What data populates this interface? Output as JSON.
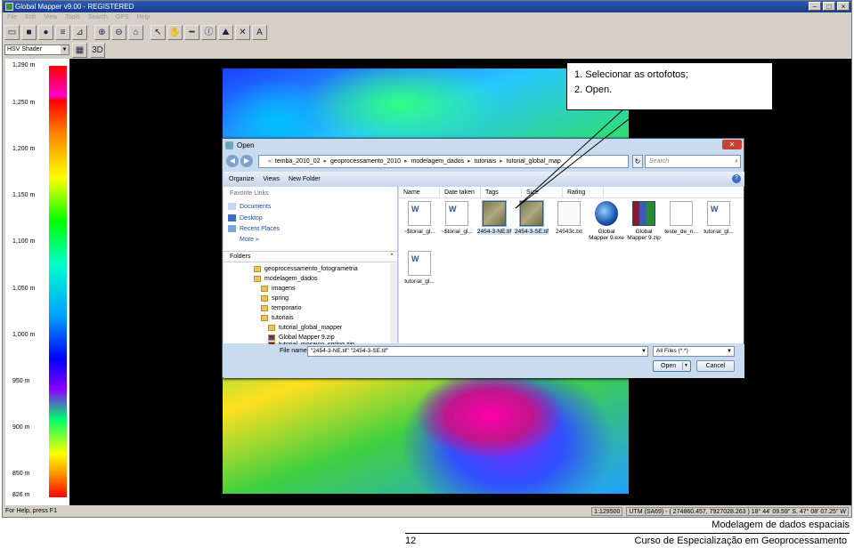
{
  "app": {
    "title": "Global Mapper v9.00 - REGISTERED",
    "menu": [
      "File",
      "Edit",
      "View",
      "Tools",
      "Search",
      "GPS",
      "Help"
    ],
    "shader_select": "HSV Shader",
    "status_left": "For Help, press F1",
    "status_scale": "1:129500",
    "status_coords": "UTM (SA69) - ( 274860.457, 7927028.263 ) 18° 44' 09.59\" S, 47° 08' 07.25\" W"
  },
  "legend": {
    "labels": [
      "1,290 m",
      "1,250 m",
      "1,200 m",
      "1,150 m",
      "1,100 m",
      "1,050 m",
      "1,000 m",
      "950 m",
      "900 m",
      "850 m",
      "826 m"
    ]
  },
  "callout": {
    "step1": "1. Selecionar as ortofotos;",
    "step2": "2. Open."
  },
  "dialog": {
    "title": "Open",
    "address": [
      "temba_2010_02",
      "geoprocessamento_2010",
      "modelagem_dados",
      "tutoriais",
      "tutorial_global_map"
    ],
    "search_placeholder": "Search",
    "commands": [
      "Organize",
      "Views",
      "New Folder"
    ],
    "favorites_header": "Favorite Links",
    "favorites": [
      "Documents",
      "Desktop",
      "Recent Places"
    ],
    "more": "More »",
    "folders_header": "Folders",
    "folders": [
      "geoprocessamento_fotogrametria",
      "modelagem_dados",
      "imagens",
      "spring",
      "temporario",
      "tutoriais",
      "tutorial_global_mapper",
      "Global Mapper 9.zip",
      "tutorial_mosaico_spring.zip"
    ],
    "columns": [
      "Name",
      "Date taken",
      "Tags",
      "Size",
      "Rating"
    ],
    "files": [
      {
        "name": "~$torial_gl...",
        "kind": "doc"
      },
      {
        "name": "~$torial_gl...",
        "kind": "doc"
      },
      {
        "name": "2454-3-NE.tif",
        "kind": "tif"
      },
      {
        "name": "2454-3-SE.tif",
        "kind": "tif"
      },
      {
        "name": "24543c.txt",
        "kind": "txt"
      },
      {
        "name": "Global Mapper 9.exe",
        "kind": "globe"
      },
      {
        "name": "Global Mapper 9.zip",
        "kind": "zip"
      },
      {
        "name": "teste_de_n...",
        "kind": "file"
      },
      {
        "name": "tutorial_gl...",
        "kind": "doc"
      },
      {
        "name": "tutorial_gl...",
        "kind": "doc"
      }
    ],
    "filename_label": "File name:",
    "filename_value": "\"2454-3-NE.tif\" \"2454-3-SE.tif\"",
    "filter_value": "All Files (*.*)",
    "open_label": "Open",
    "cancel_label": "Cancel"
  },
  "footer": {
    "title": "Modelagem de dados espaciais",
    "page": "12",
    "course": "Curso de Especialização em Geoprocessamento"
  }
}
